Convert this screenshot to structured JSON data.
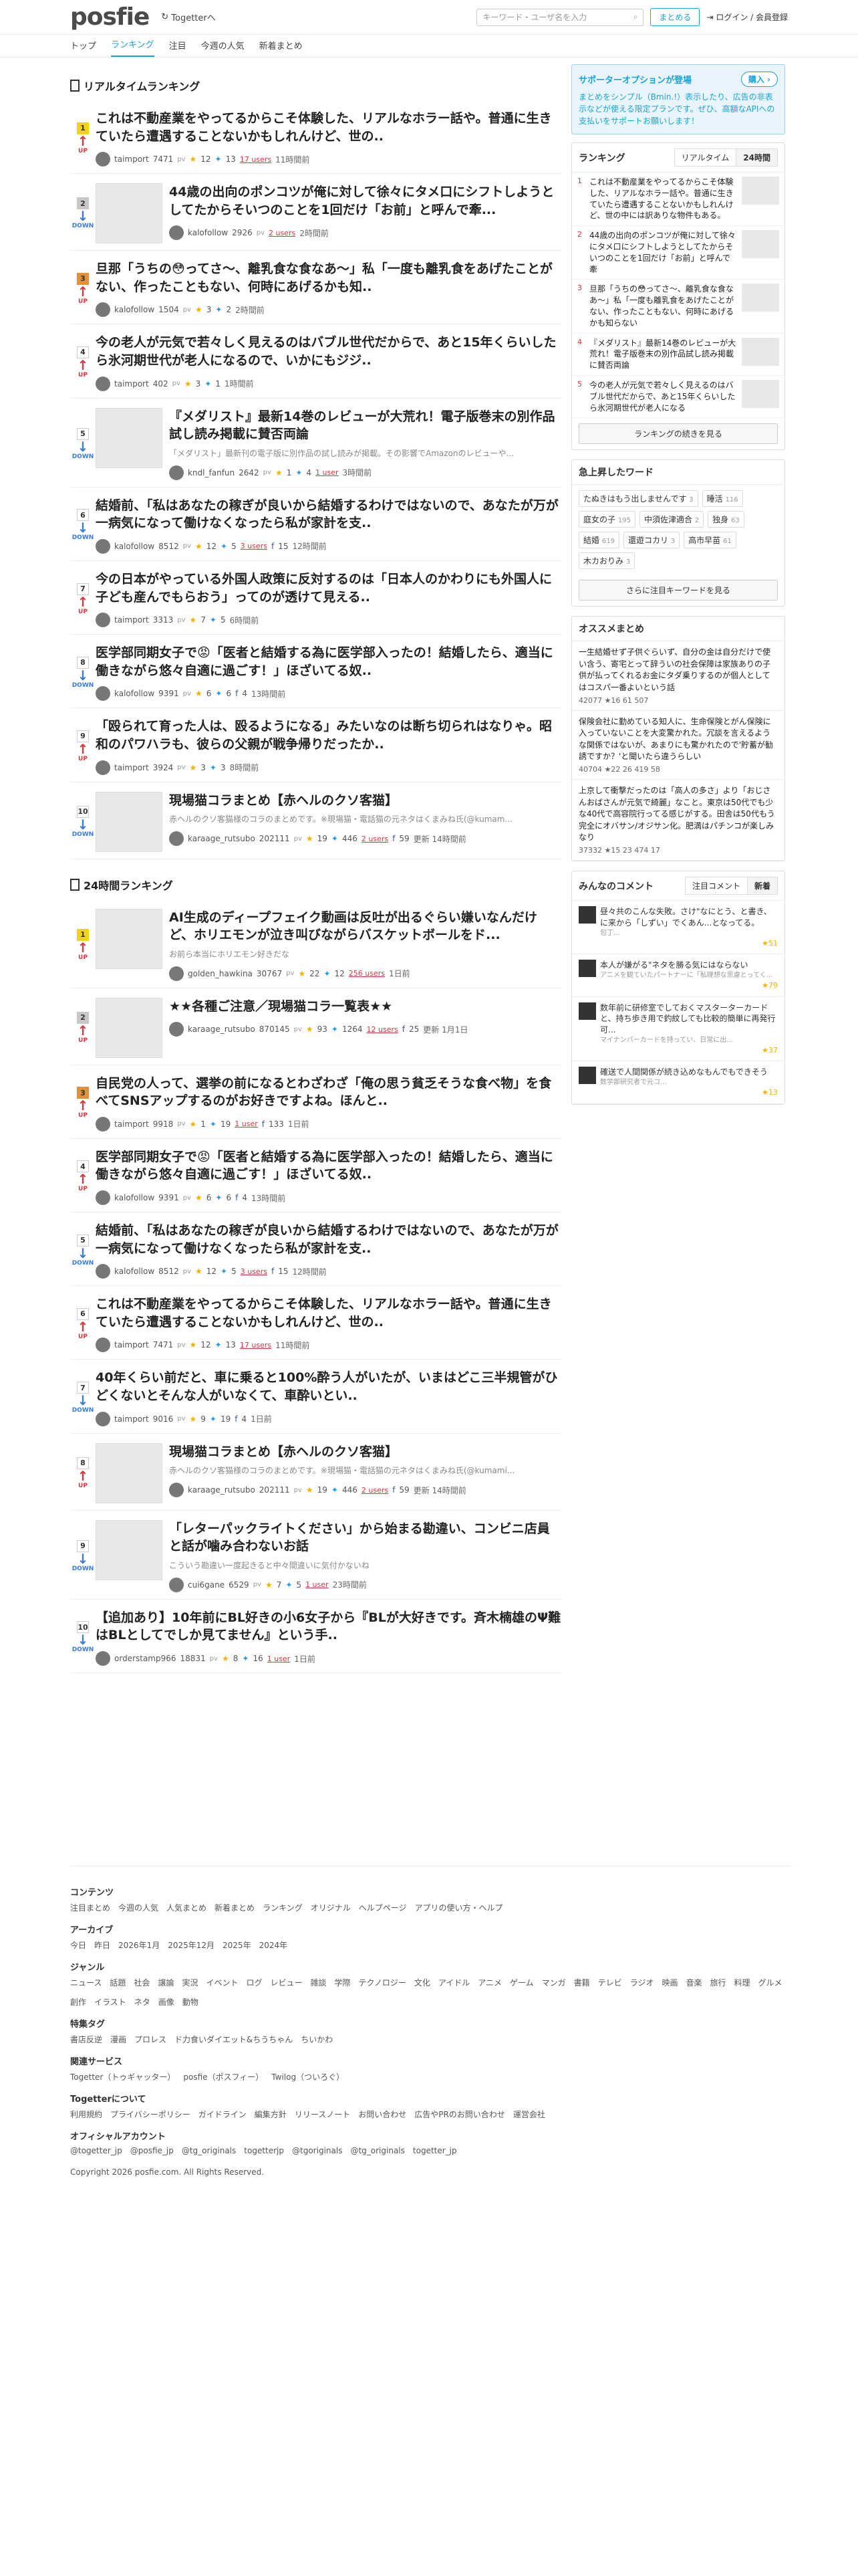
{
  "header": {
    "logo": "posfie",
    "togetter": "Togetterへ",
    "search_placeholder": "キーワード・ユーザ名を入力",
    "matome_btn": "まとめる",
    "login": "ログイン / 会員登録"
  },
  "nav": [
    "トップ",
    "ランキング",
    "注目",
    "今週の人気",
    "新着まとめ"
  ],
  "realtime": {
    "title": "リアルタイムランキング",
    "items": [
      {
        "rank": "1",
        "trend": "up",
        "title": "これは不動産業をやってるからこそ体験した、リアルなホラー話や。普通に生きていたら遭遇することないかもしれんけど、世の..",
        "user": "taimport",
        "pt": "7471",
        "stars": "12",
        "rt": "13",
        "users": "17 users",
        "time": "11時間前",
        "thumb": false
      },
      {
        "rank": "2",
        "trend": "down",
        "title": "44歳の出向のポンコツが俺に対して徐々にタメ口にシフトしようとしてたからそいつのことを1回だけ「お前」と呼んで牽...",
        "user": "kalofollow",
        "pt": "2926",
        "stars": "",
        "rt": "",
        "users": "2 users",
        "time": "2時間前",
        "thumb": true
      },
      {
        "rank": "3",
        "trend": "up",
        "title": "旦那「うちの😳ってさ〜、離乳食な食なあ〜」私「一度も離乳食をあげたことがない、作ったこともない、何時にあげるかも知..",
        "user": "kalofollow",
        "pt": "1504",
        "stars": "3",
        "rt": "2",
        "users": "",
        "time": "2時間前",
        "thumb": false
      },
      {
        "rank": "4",
        "trend": "up",
        "title": "今の老人が元気で若々しく見えるのはバブル世代だからで、あと15年くらいしたら氷河期世代が老人になるので、いかにもジジ..",
        "user": "taimport",
        "pt": "402",
        "stars": "3",
        "rt": "1",
        "users": "",
        "time": "1時間前",
        "thumb": false
      },
      {
        "rank": "5",
        "trend": "down",
        "title": "『メダリスト』最新14巻のレビューが大荒れ！電子版巻末の別作品試し読み掲載に賛否両論",
        "desc": "「メダリスト」最新刊の電子版に別作品の試し読みが掲載。その影響でAmazonのレビューや...",
        "user": "kndl_fanfun",
        "pt": "2642",
        "stars": "1",
        "rt": "4",
        "users": "1 user",
        "time": "3時間前",
        "thumb": true
      },
      {
        "rank": "6",
        "trend": "down",
        "title": "結婚前、「私はあなたの稼ぎが良いから結婚するわけではないので、あなたが万が一病気になって働けなくなったら私が家計を支..",
        "user": "kalofollow",
        "pt": "8512",
        "stars": "12",
        "rt": "5",
        "users": "3 users",
        "fb": "15",
        "time": "12時間前",
        "thumb": false
      },
      {
        "rank": "7",
        "trend": "up",
        "title": "今の日本がやっている外国人政策に反対するのは「日本人のかわりにも外国人に子ども産んでもらおう」ってのが透けて見える..",
        "user": "taimport",
        "pt": "3313",
        "stars": "7",
        "rt": "5",
        "users": "",
        "time": "6時間前",
        "thumb": false
      },
      {
        "rank": "8",
        "trend": "down",
        "title": "医学部同期女子で😡「医者と結婚する為に医学部入ったの！結婚したら、適当に働きながら悠々自適に過ごす！」ほざいてる奴..",
        "user": "kalofollow",
        "pt": "9391",
        "stars": "6",
        "rt": "6",
        "users": "",
        "fb": "4",
        "time": "13時間前",
        "thumb": false
      },
      {
        "rank": "9",
        "trend": "up",
        "title": "「殴られて育った人は、殴るようになる」みたいなのは断ち切られはなりゃ。昭和のパワハラも、彼らの父親が戦争帰りだったか..",
        "user": "taimport",
        "pt": "3924",
        "stars": "3",
        "rt": "3",
        "users": "",
        "time": "8時間前",
        "thumb": false
      },
      {
        "rank": "10",
        "trend": "down",
        "title": "現場猫コラまとめ【赤ヘルのクソ客猫】",
        "desc": "赤ヘルのクソ客猫様のコラのまとめです。※現場猫・電話猫の元ネタはくまみね氏(@kumam...",
        "user": "karaage_rutsubo",
        "pt": "202111",
        "stars": "19",
        "rt": "446",
        "users": "2 users",
        "fb": "59",
        "time": "更新 14時間前",
        "thumb": true
      }
    ]
  },
  "daily": {
    "title": "24時間ランキング",
    "items": [
      {
        "rank": "1",
        "trend": "up",
        "title": "AI生成のディープフェイク動画は反吐が出るぐらい嫌いなんだけど、ホリエモンが泣き叫びながらバスケットボールをド...",
        "desc": "お前ら本当にホリエモン好きだな",
        "user": "golden_hawkina",
        "pt": "30767",
        "stars": "22",
        "rt": "12",
        "users": "256 users",
        "time": "1日前",
        "thumb": true
      },
      {
        "rank": "2",
        "trend": "up",
        "title": "★★各種ご注意／現場猫コラ一覧表★★",
        "desc": "",
        "user": "karaage_rutsubo",
        "pt": "870145",
        "stars": "93",
        "rt": "1264",
        "users": "12 users",
        "fb": "25",
        "time": "更新 1月1日",
        "thumb": true
      },
      {
        "rank": "3",
        "trend": "up",
        "title": "自民党の人って、選挙の前になるとわざわざ「俺の思う貧乏そうな食べ物」を食べてSNSアップするのがお好きですよね。ほんと..",
        "user": "taimport",
        "pt": "9918",
        "stars": "1",
        "rt": "19",
        "users": "1 user",
        "fb": "133",
        "time": "1日前",
        "thumb": false
      },
      {
        "rank": "4",
        "trend": "up",
        "title": "医学部同期女子で😡「医者と結婚する為に医学部入ったの！結婚したら、適当に働きながら悠々自適に過ごす！」ほざいてる奴..",
        "user": "kalofollow",
        "pt": "9391",
        "stars": "6",
        "rt": "6",
        "users": "",
        "fb": "4",
        "time": "13時間前",
        "thumb": false
      },
      {
        "rank": "5",
        "trend": "down",
        "title": "結婚前、「私はあなたの稼ぎが良いから結婚するわけではないので、あなたが万が一病気になって働けなくなったら私が家計を支..",
        "user": "kalofollow",
        "pt": "8512",
        "stars": "12",
        "rt": "5",
        "users": "3 users",
        "fb": "15",
        "time": "12時間前",
        "thumb": false
      },
      {
        "rank": "6",
        "trend": "up",
        "title": "これは不動産業をやってるからこそ体験した、リアルなホラー話や。普通に生きていたら遭遇することないかもしれんけど、世の..",
        "user": "taimport",
        "pt": "7471",
        "stars": "12",
        "rt": "13",
        "users": "17 users",
        "time": "11時間前",
        "thumb": false
      },
      {
        "rank": "7",
        "trend": "down",
        "title": "40年くらい前だと、車に乗ると100%酔う人がいたが、いまはどこ三半規管がひどくないとそんな人がいなくて、車酔いとい..",
        "user": "taimport",
        "pt": "9016",
        "stars": "9",
        "rt": "19",
        "users": "",
        "fb": "4",
        "time": "1日前",
        "thumb": false
      },
      {
        "rank": "8",
        "trend": "up",
        "title": "現場猫コラまとめ【赤ヘルのクソ客猫】",
        "desc": "赤ヘルのクソ客猫様のコラのまとめです。※現場猫・電話猫の元ネタはくまみね氏(@kumami...",
        "user": "karaage_rutsubo",
        "pt": "202111",
        "stars": "19",
        "rt": "446",
        "users": "2 users",
        "fb": "59",
        "time": "更新 14時間前",
        "thumb": true
      },
      {
        "rank": "9",
        "trend": "down",
        "title": "「レターパックライトください」から始まる勘違い、コンビニ店員と話が噛み合わないお話",
        "desc": "こういう勘違い一度起きると中々間違いに気付かないね",
        "user": "cui6gane",
        "pt": "6529",
        "stars": "7",
        "rt": "5",
        "users": "1 user",
        "time": "23時間前",
        "thumb": true
      },
      {
        "rank": "10",
        "trend": "down",
        "title": "【追加あり】10年前にBL好きの小6女子から『BLが大好きです。斉木楠雄のΨ難はBLとしてでしか見てません』という手..",
        "user": "orderstamp966",
        "pt": "18831",
        "stars": "8",
        "rt": "16",
        "users": "1 user",
        "time": "1日前",
        "thumb": false
      }
    ]
  },
  "sidebar": {
    "support": {
      "title": "サポーターオプションが登場",
      "buy": "購入",
      "text": "まとめをシンプル（Bmin.!）表示したり、広告の非表示などが使える限定プランです。ぜひ、高額なAPIへの支払いをサポートお願いします！"
    },
    "ranking": {
      "title": "ランキング",
      "tab1": "リアルタイム",
      "tab2": "24時間",
      "items": [
        {
          "n": "1",
          "t": "これは不動産業をやってるからこそ体験した、リアルなホラー話や。普通に生きていたら遭遇することないかもしれんけど、世の中には訳ありな物件もある。"
        },
        {
          "n": "2",
          "t": "44歳の出向のポンコツが俺に対して徐々にタメ口にシフトしようとしてたからそいつのことを1回だけ「お前」と呼んで牽"
        },
        {
          "n": "3",
          "t": "旦那「うちの😳ってさ〜、離乳食な食なあ〜」私「一度も離乳食をあげたことがない、作ったこともない、何時にあげるかも知らない"
        },
        {
          "n": "4",
          "t": "『メダリスト』最新14巻のレビューが大荒れ！電子版巻末の別作品試し読み掲載に賛否両論"
        },
        {
          "n": "5",
          "t": "今の老人が元気で若々しく見えるのはバブル世代だからで、あと15年くらいしたら氷河期世代が老人になる"
        }
      ],
      "more": "ランキングの続きを見る"
    },
    "keywords": {
      "title": "急上昇したワード",
      "items": [
        {
          "w": "たぬきはもう出しませんです",
          "n": "3"
        },
        {
          "w": "睡活",
          "n": "116"
        },
        {
          "w": "庭女の子",
          "n": "195"
        },
        {
          "w": "中須佐津適合",
          "n": "2"
        },
        {
          "w": "独身",
          "n": "63"
        },
        {
          "w": "結婚",
          "n": "619"
        },
        {
          "w": "還遊コカリ",
          "n": "3"
        },
        {
          "w": "高市早苗",
          "n": "61"
        },
        {
          "w": "木カおりみ",
          "n": "3"
        }
      ],
      "more": "さらに注目キーワードを見る"
    },
    "recommend": {
      "title": "オススメまとめ",
      "items": [
        {
          "t": "一生結婚せず子供ぐらいず、自分の金は自分だけで使い含う、寄宅とって辞ういの社会保障は家族ありの子供が払ってくれるお金にタダ乗りするのが個人としてはコスパ一番よいという話",
          "m": "42077 ★16 61 507"
        },
        {
          "t": "保険会社に勤めている知人に、生命保険とがん保険に入っていないことを大変驚かれた。冗談を言えるような関係ではないが、あまりにも驚かれたので'貯蓄が勧誘ですか？'と聞いたら違うらしい",
          "m": "40704 ★22 26 419 58"
        },
        {
          "t": "上京して衝撃だったのは「高人の多さ」より「おじさんおばさんが元気で綺麗」なこと。東京は50代でも少な40代で高容院行ってる感じがする。田舎は50代もう完全にオバサン/オジサン化。肥満はパチンコが楽しみなり",
          "m": "37332 ★15 23 474 17"
        }
      ]
    },
    "comments": {
      "title": "みんなのコメント",
      "tab1": "注目コメント",
      "tab2": "新着",
      "items": [
        {
          "t": "昼々共のこんな失敗。さけ\"なにとう、と書き、に来から「しずい」でくあん...となってる。",
          "s": "包丁...",
          "st": "51"
        },
        {
          "t": "本人が嫌がる\"ネタを勝る気にはならない",
          "s": "アニメを観ていたパートナーに「私理想な思慮とってく...",
          "st": "79"
        },
        {
          "t": "数年前に研修室でしておくマスターターカードと、持ち歩き用で釣紋しても比較的簡単に再発行可...",
          "s": "マイナンバーカードを持ってい、日常に出...",
          "st": "37"
        },
        {
          "t": "確送で人間関係が続き込めなもんでもできそう",
          "s": "数学部研究者で元コ...",
          "st": "13"
        }
      ]
    }
  },
  "footer": {
    "contents": {
      "title": "コンテンツ",
      "items": [
        "注目まとめ",
        "今週の人気",
        "人気まとめ",
        "新着まとめ",
        "ランキング",
        "オリジナル",
        "ヘルプページ",
        "アプリの使い方・ヘルプ"
      ]
    },
    "archive": {
      "title": "アーカイブ",
      "items": [
        "今日",
        "昨日",
        "2026年1月",
        "2025年12月",
        "2025年",
        "2024年"
      ]
    },
    "genre": {
      "title": "ジャンル",
      "items": [
        "ニュース",
        "話題",
        "社会",
        "譲論",
        "実況",
        "イベント",
        "ログ",
        "レビュー",
        "雑談",
        "学際",
        "テクノロジー",
        "文化",
        "アイドル",
        "アニメ",
        "ゲーム",
        "マンガ",
        "書籍",
        "テレビ",
        "ラジオ",
        "映画",
        "音楽",
        "旅行",
        "料理",
        "グルメ",
        "創作",
        "イラスト",
        "ネタ",
        "画像",
        "動物"
      ]
    },
    "special": {
      "title": "特集タグ",
      "items": [
        "書店反逆",
        "漫画",
        "プロレス",
        "ド力食いダイエット&ちうちゃん",
        "ちいかわ"
      ]
    },
    "related": {
      "title": "関連サービス",
      "items": [
        "Togetter（トゥギャッター）",
        "posfie（ポスフィー）",
        "Twilog（ついろぐ）"
      ]
    },
    "about": {
      "title": "Togetterについて",
      "items": [
        "利用規約",
        "プライバシーポリシー",
        "ガイドライン",
        "編集方針",
        "リリースノート",
        "お問い合わせ",
        "広告やPRのお問い合わせ",
        "運営会社"
      ]
    },
    "official": {
      "title": "オフィシャルアカウント",
      "items": [
        "@togetter_jp",
        "@posfie_jp",
        "@tg_originals",
        "togetterjp",
        "@tgoriginals",
        "@tg_originals",
        "togetter_jp"
      ]
    },
    "copyright": "Copyright 2026 posfie.com. All Rights Reserved."
  }
}
